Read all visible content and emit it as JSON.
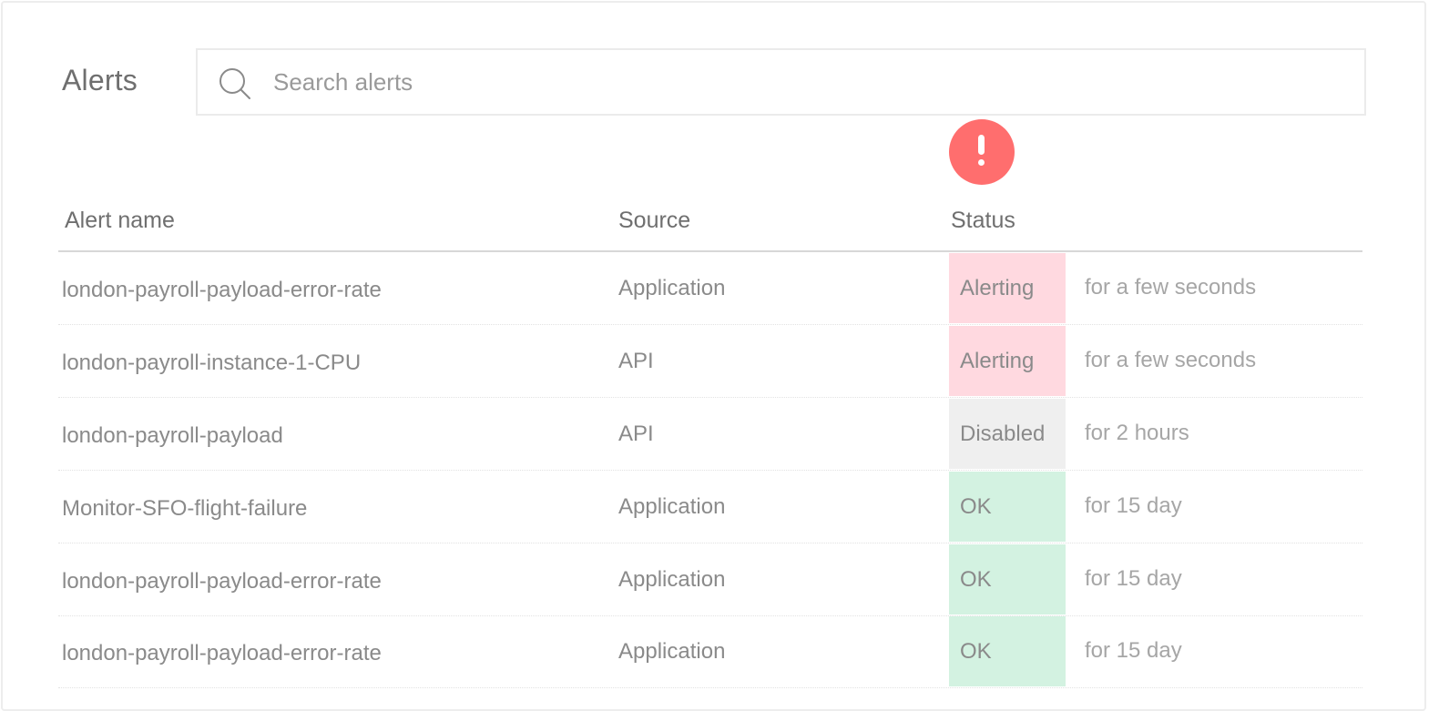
{
  "page": {
    "title": "Alerts"
  },
  "search": {
    "placeholder": "Search alerts",
    "value": "",
    "icon": "search-icon"
  },
  "alert_indicator": {
    "icon": "exclamation-icon",
    "color": "#ff6e6e"
  },
  "table": {
    "columns": {
      "name": "Alert name",
      "source": "Source",
      "status": "Status"
    },
    "status_colors": {
      "Alerting": "#ffd9e0",
      "Disabled": "#efefef",
      "OK": "#d3f2e1"
    },
    "rows": [
      {
        "name": "london-payroll-payload-error-rate",
        "source": "Application",
        "status": "Alerting",
        "duration": "for a few seconds"
      },
      {
        "name": "london-payroll-instance-1-CPU",
        "source": "API",
        "status": "Alerting",
        "duration": "for a few seconds"
      },
      {
        "name": "london-payroll-payload",
        "source": "API",
        "status": "Disabled",
        "duration": "for 2 hours"
      },
      {
        "name": "Monitor-SFO-flight-failure",
        "source": "Application",
        "status": "OK",
        "duration": "for 15 day"
      },
      {
        "name": "london-payroll-payload-error-rate",
        "source": "Application",
        "status": "OK",
        "duration": "for 15 day"
      },
      {
        "name": "london-payroll-payload-error-rate",
        "source": "Application",
        "status": "OK",
        "duration": "for 15 day"
      }
    ]
  }
}
